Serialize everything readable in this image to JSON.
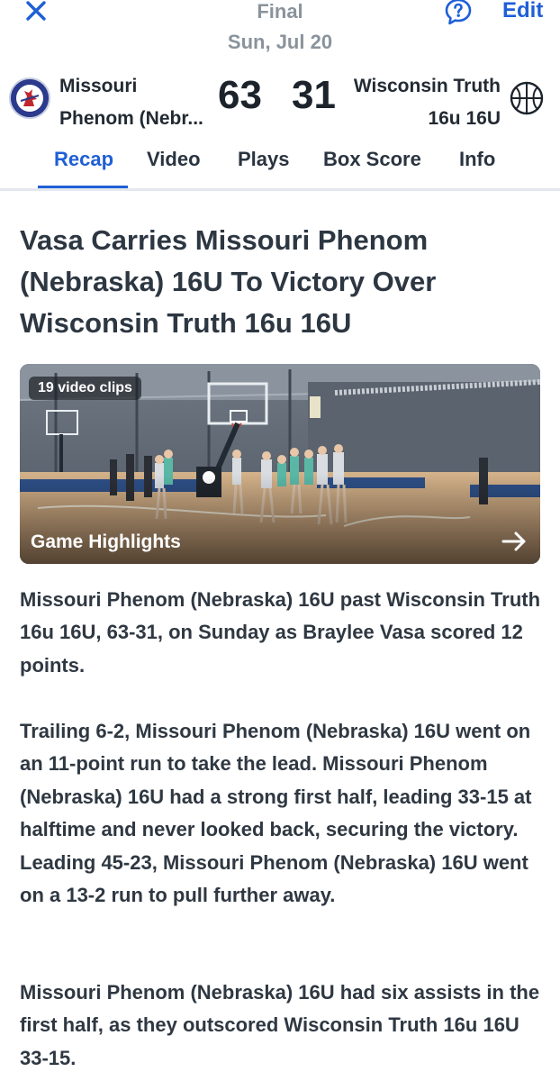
{
  "header": {
    "status": "Final",
    "date": "Sun, Jul 20",
    "edit_label": "Edit"
  },
  "scoreboard": {
    "home": {
      "name_line1": "Missouri",
      "name_line2": "Phenom (Nebr...",
      "score": "63"
    },
    "away": {
      "name_line1": "Wisconsin Truth",
      "name_line2": "16u 16U",
      "score": "31"
    }
  },
  "tabs": [
    {
      "label": "Recap",
      "active": true
    },
    {
      "label": "Video",
      "active": false
    },
    {
      "label": "Plays",
      "active": false
    },
    {
      "label": "Box Score",
      "active": false
    },
    {
      "label": "Info",
      "active": false
    }
  ],
  "article": {
    "headline": "Vasa Carries Missouri Phenom (Nebraska) 16U To Victory Over Wisconsin Truth 16u 16U",
    "video": {
      "clip_count": "19 video clips",
      "label": "Game Highlights"
    },
    "paragraphs": [
      "Missouri Phenom (Nebraska) 16U past Wisconsin Truth 16u 16U, 63-31, on Sunday as Braylee Vasa scored 12 points.",
      "Trailing 6-2, Missouri Phenom (Nebraska) 16U went on an 11-point run to take the lead. Missouri Phenom (Nebraska) 16U had a strong first half, leading 33-15 at halftime and never looked back, securing the victory. Leading 45-23, Missouri Phenom (Nebraska) 16U went on a 13-2 run to pull further away.",
      "Missouri Phenom (Nebraska) 16U had six assists in the first half, as they outscored Wisconsin Truth 16u 16U 33-15."
    ]
  },
  "colors": {
    "accent": "#1f5fd6",
    "muted": "#8a939c",
    "text": "#2f3842"
  }
}
